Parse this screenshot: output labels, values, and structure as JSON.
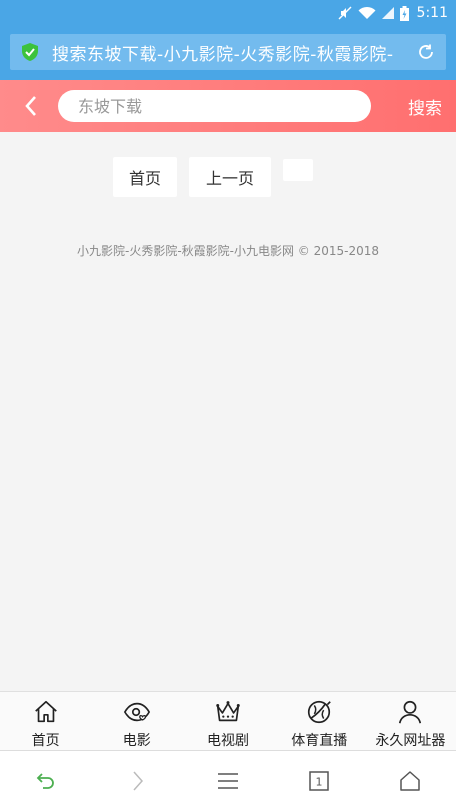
{
  "status_bar": {
    "time": "5:11",
    "icons": [
      "mute-icon",
      "wifi-icon",
      "signal-icon",
      "battery-icon"
    ]
  },
  "url_bar": {
    "title": "搜索东坡下载-小九影院-火秀影院-秋霞影院-",
    "icons": [
      "shield-check-icon",
      "reload-icon"
    ]
  },
  "search": {
    "value": "",
    "placeholder": "东坡下载",
    "button_label": "搜索"
  },
  "pager": {
    "home_label": "首页",
    "prev_label": "上一页",
    "blank_label": ""
  },
  "footer": {
    "copyright": "小九影院-火秀影院-秋霞影院-小九电影网 © 2015-2018"
  },
  "bottom_nav": {
    "items": [
      {
        "label": "首页",
        "icon": "home-icon"
      },
      {
        "label": "电影",
        "icon": "eye-heart-icon"
      },
      {
        "label": "电视剧",
        "icon": "crown-icon"
      },
      {
        "label": "体育直播",
        "icon": "ball-icon"
      },
      {
        "label": "永久网址器",
        "icon": "user-icon"
      }
    ]
  },
  "browser_toolbar": {
    "tab_count": "1",
    "icons": [
      "back-arrow-icon",
      "forward-arrow-icon",
      "menu-icon",
      "tabs-icon",
      "home-outline-icon"
    ]
  },
  "colors": {
    "status_bar": "#4aa6e6",
    "header_gradient_start": "#ff8b8b",
    "header_gradient_end": "#ff6f6f",
    "back_accent": "#4caf50"
  }
}
